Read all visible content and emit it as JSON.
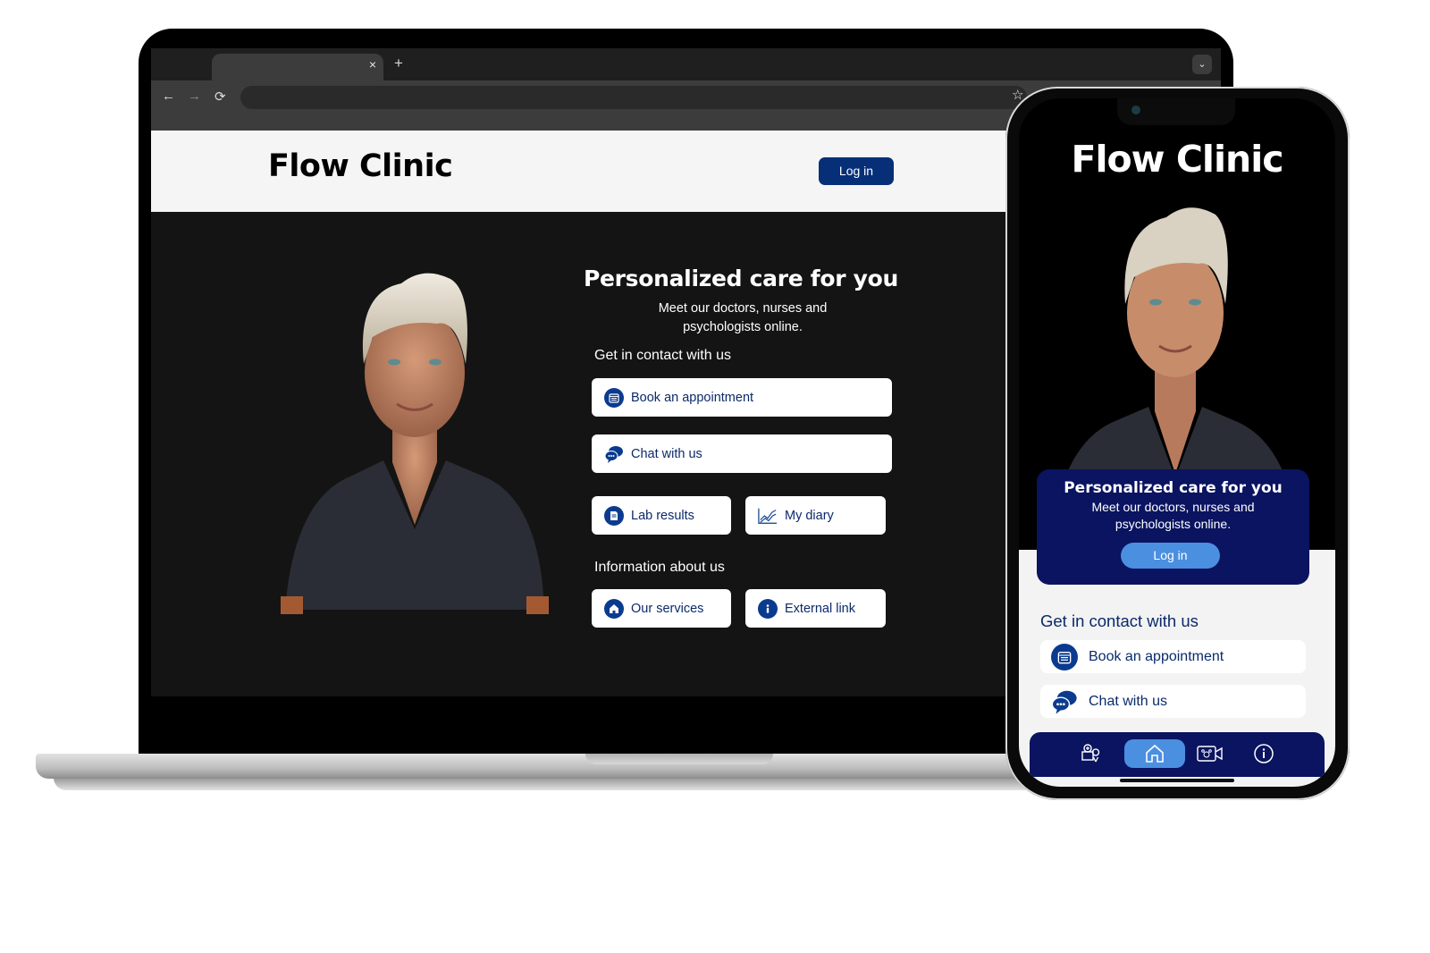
{
  "laptop": {
    "browser": {
      "tab_close": "×",
      "new_tab": "+",
      "back": "←",
      "forward": "→",
      "reload": "⟳",
      "bookmark": "☆",
      "tab_menu": "⌄"
    },
    "site": {
      "brand": "Flow Clinic",
      "login_label": "Log in",
      "hero_title": "Personalized care for you",
      "hero_subtitle": "Meet our doctors, nurses and psychologists online.",
      "contact_heading": "Get in contact with us",
      "contact_items": [
        {
          "label": "Book an appointment",
          "icon": "calendar-icon"
        },
        {
          "label": "Chat with us",
          "icon": "chat-icon"
        },
        {
          "label": "Lab results",
          "icon": "document-icon"
        },
        {
          "label": "My diary",
          "icon": "line-chart-icon"
        }
      ],
      "info_heading": "Information about us",
      "info_items": [
        {
          "label": "Our services",
          "icon": "home-icon"
        },
        {
          "label": "External link",
          "icon": "info-icon"
        }
      ]
    }
  },
  "phone": {
    "brand": "Flow Clinic",
    "hero_title": "Personalized care for you",
    "hero_subtitle": "Meet our doctors, nurses and psychologists online.",
    "login_label": "Log in",
    "contact_heading": "Get in contact with us",
    "contact_items": [
      {
        "label": "Book an appointment",
        "icon": "calendar-icon"
      },
      {
        "label": "Chat with us",
        "icon": "chat-icon"
      }
    ],
    "nav": [
      {
        "icon": "clinic-location-icon",
        "active": false
      },
      {
        "icon": "home-icon",
        "active": true
      },
      {
        "icon": "video-call-icon",
        "active": false
      },
      {
        "icon": "info-icon",
        "active": false
      }
    ]
  },
  "colors": {
    "brand_navy": "#0a1460",
    "button_navy": "#062f78",
    "accent_blue": "#4b8fe0",
    "text_navy": "#0b2a6b"
  }
}
